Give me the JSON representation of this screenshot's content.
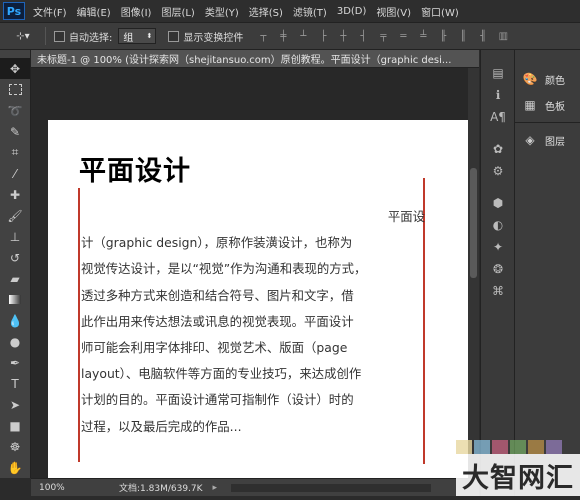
{
  "app": {
    "logo": "Ps"
  },
  "menu": [
    "文件(F)",
    "编辑(E)",
    "图像(I)",
    "图层(L)",
    "类型(Y)",
    "选择(S)",
    "滤镜(T)",
    "3D(D)",
    "视图(V)",
    "窗口(W)"
  ],
  "options": {
    "auto_select_label": "自动选择:",
    "auto_select_value": "组",
    "show_transform_label": "显示变换控件"
  },
  "document": {
    "tab_title": "未标题-1 @ 100% (设计探索网（shejitansuo.com）原创教程。平面设计（graphic desi...",
    "heading": "平面设计",
    "body_lines": [
      "平面设",
      "计（graphic design），原称作装潢设计，也称为",
      "视觉传达设计，是以“视觉”作为沟通和表现的方式，",
      "透过多种方式来创造和结合符号、图片和文字，借",
      "此作出用来传达想法或讯息的视觉表现。平面设计",
      "师可能会利用字体排印、视觉艺术、版面（page",
      "layout）、电脑软件等方面的专业技巧，来达成创作",
      "计划的目的。平面设计通常可指制作（设计）时的",
      "过程，以及最后完成的作品..."
    ]
  },
  "status": {
    "zoom": "100%",
    "doc_size": "文档:1.83M/639.7K"
  },
  "panels": {
    "color": "颜色",
    "swatches": "色板",
    "layers": "图层"
  },
  "watermark": {
    "text": "大智网汇"
  },
  "colors": {
    "guide_line": "#c0392b",
    "ps_blue": "#31a8ff"
  }
}
